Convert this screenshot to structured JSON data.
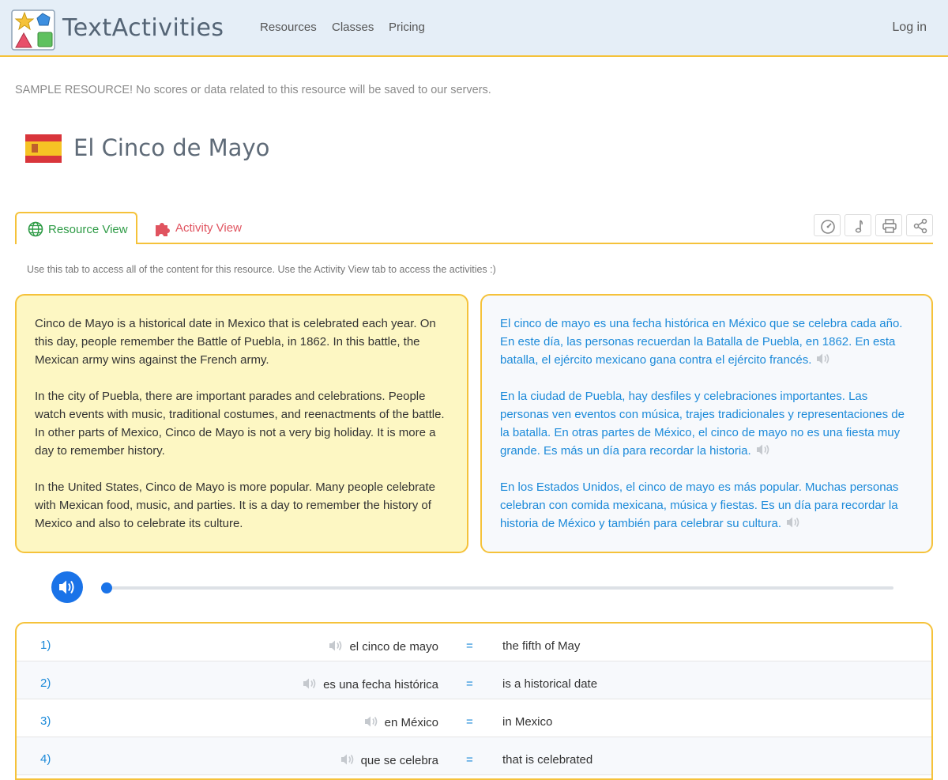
{
  "header": {
    "brand": "TextActivities",
    "nav": [
      "Resources",
      "Classes",
      "Pricing"
    ],
    "login": "Log in"
  },
  "notice": "SAMPLE RESOURCE! No scores or data related to this resource will be saved to our servers.",
  "title": "El Cinco de Mayo",
  "tabs": {
    "resource": "Resource View",
    "activity": "Activity View"
  },
  "hint": "Use this tab to access all of the content for this resource. Use the Activity View tab to access the activities :)",
  "english": [
    "Cinco de Mayo is a historical date in Mexico that is celebrated each year. On this day, people remember the Battle of Puebla, in 1862. In this battle, the Mexican army wins against the French army.",
    "In the city of Puebla, there are important parades and celebrations. People watch events with music, traditional costumes, and reenactments of the battle. In other parts of Mexico, Cinco de Mayo is not a very big holiday. It is more a day to remember history.",
    "In the United States, Cinco de Mayo is more popular. Many people celebrate with Mexican food, music, and parties. It is a day to remember the history of Mexico and also to celebrate its culture."
  ],
  "spanish": [
    "El cinco de mayo es una fecha histórica en México que se celebra cada año. En este día, las personas recuerdan la Batalla de Puebla, en 1862. En esta batalla, el ejército mexicano gana contra el ejército francés.",
    "En la ciudad de Puebla, hay desfiles y celebraciones importantes. Las personas ven eventos con música, trajes tradicionales y representaciones de la batalla. En otras partes de México, el cinco de mayo no es una fiesta muy grande. Es más un día para recordar la historia.",
    "En los Estados Unidos, el cinco de mayo es más popular. Muchas personas celebran con comida mexicana, música y fiestas. Es un día para recordar la historia de México y también para celebrar su cultura."
  ],
  "audio": {
    "progress": 0
  },
  "vocab": [
    {
      "num": "1)",
      "es": "el cinco de mayo",
      "eq": "=",
      "en": "the fifth of May"
    },
    {
      "num": "2)",
      "es": "es una fecha histórica",
      "eq": "=",
      "en": "is a historical date"
    },
    {
      "num": "3)",
      "es": "en México",
      "eq": "=",
      "en": "in Mexico"
    },
    {
      "num": "4)",
      "es": "que se celebra",
      "eq": "=",
      "en": "that is celebrated"
    }
  ],
  "colors": {
    "accent_yellow": "#f5c23a",
    "header_bg": "#e5eef7",
    "english_panel_bg": "#fdf7c3",
    "spanish_text": "#1c8ad9",
    "resource_tab": "#2e9b46",
    "activity_tab": "#e0535f",
    "audio_blue": "#1a73e8"
  },
  "icons": {
    "logo": "shapes-logo-icon",
    "flag": "spain-flag-icon",
    "resource_tab": "globe-icon",
    "activity_tab": "puzzle-icon",
    "toolbar": [
      "speedometer-icon",
      "music-note-icon",
      "printer-icon",
      "share-icon"
    ],
    "audio": "speaker-icon"
  }
}
